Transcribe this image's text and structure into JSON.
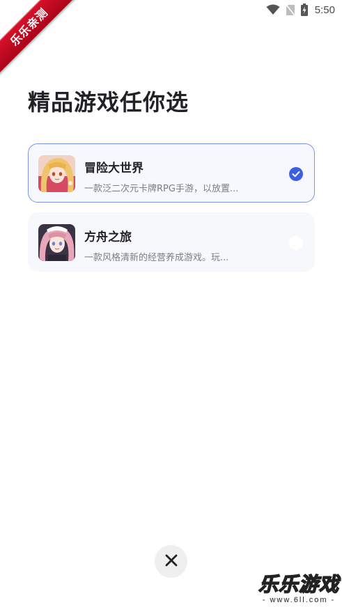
{
  "status_bar": {
    "time": "5:50",
    "icons": [
      "wifi-icon",
      "no-sim-icon",
      "battery-charging-icon"
    ]
  },
  "ribbon": {
    "text": "乐乐亲测",
    "color": "#c80a22"
  },
  "page": {
    "title": "精品游戏任你选"
  },
  "games": [
    {
      "name": "冒险大世界",
      "description": "一款泛二次元卡牌RPG手游，以放置...",
      "selected": true,
      "thumbnail": "anime-girl-blonde"
    },
    {
      "name": "方舟之旅",
      "description": "一款风格清新的经营养成游戏。玩...",
      "selected": false,
      "thumbnail": "anime-girl-pink-hair"
    }
  ],
  "close_button": {
    "icon": "close-icon"
  },
  "watermark": {
    "title": "乐乐游戏",
    "subtitle": "- www.6ll.com -"
  },
  "colors": {
    "accent": "#3b5fe0",
    "selected_border": "#7a95e8",
    "card_bg": "#f7f8fb"
  }
}
